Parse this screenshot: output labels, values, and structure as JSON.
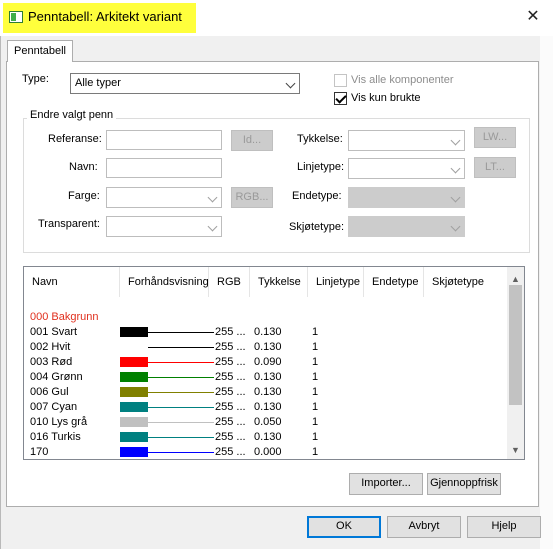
{
  "window": {
    "title": "Penntabell: Arkitekt variant",
    "close_glyph": "✕"
  },
  "tab": {
    "label": "Penntabell"
  },
  "type_row": {
    "label": "Type:",
    "value": "Alle typer"
  },
  "checkboxes": {
    "show_all": {
      "label": "Vis alle komponenter",
      "checked": false,
      "enabled": false
    },
    "show_used": {
      "label": "Vis kun brukte",
      "checked": true,
      "enabled": true
    }
  },
  "group": {
    "title": "Endre valgt penn",
    "referanse_label": "Referanse:",
    "navn_label": "Navn:",
    "farge_label": "Farge:",
    "transparent_label": "Transparent:",
    "tykkelse_label": "Tykkelse:",
    "linjetype_label": "Linjetype:",
    "endetype_label": "Endetype:",
    "skjotetype_label": "Skjøtetype:",
    "id_button": "Id...",
    "rgb_button": "RGB...",
    "lw_button": "LW...",
    "lt_button": "LT..."
  },
  "list": {
    "columns": [
      "Navn",
      "Forhåndsvisning",
      "RGB",
      "Tykkelse",
      "Linjetype",
      "Endetype",
      "Skjøtetype"
    ],
    "rows": [
      {
        "name": "000 Bakgrunn",
        "color": "",
        "rgb": "",
        "thickness": "",
        "linetype": "",
        "name_color": "#e0301e"
      },
      {
        "name": "001  Svart",
        "color": "#000000",
        "rgb": "255 ...",
        "thickness": "0.130",
        "linetype": "1"
      },
      {
        "name": "002  Hvit",
        "color": "#ffffff",
        "rgb": "255 ...",
        "thickness": "0.130",
        "linetype": "1"
      },
      {
        "name": "003  Rød",
        "color": "#ff0000",
        "rgb": "255 ...",
        "thickness": "0.090",
        "linetype": "1"
      },
      {
        "name": "004  Grønn",
        "color": "#008000",
        "rgb": "255 ...",
        "thickness": "0.130",
        "linetype": "1"
      },
      {
        "name": "006  Gul",
        "color": "#808000",
        "rgb": "255 ...",
        "thickness": "0.130",
        "linetype": "1"
      },
      {
        "name": "007  Cyan",
        "color": "#008080",
        "rgb": "255 ...",
        "thickness": "0.130",
        "linetype": "1"
      },
      {
        "name": "010  Lys grå",
        "color": "#c0c0c0",
        "rgb": "255 ...",
        "thickness": "0.050",
        "linetype": "1"
      },
      {
        "name": "016  Turkis",
        "color": "#008080",
        "rgb": "255 ...",
        "thickness": "0.130",
        "linetype": "1"
      },
      {
        "name": "170",
        "color": "#0000ff",
        "rgb": "255 ...",
        "thickness": "0.000",
        "linetype": "1"
      }
    ]
  },
  "buttons": {
    "importer": "Importer...",
    "refresh": "Gjennoppfrisk",
    "ok": "OK",
    "cancel": "Avbryt",
    "help": "Hjelp"
  },
  "colors": {
    "highlight": "#ffff3c",
    "default_button_border": "#0078d7"
  }
}
